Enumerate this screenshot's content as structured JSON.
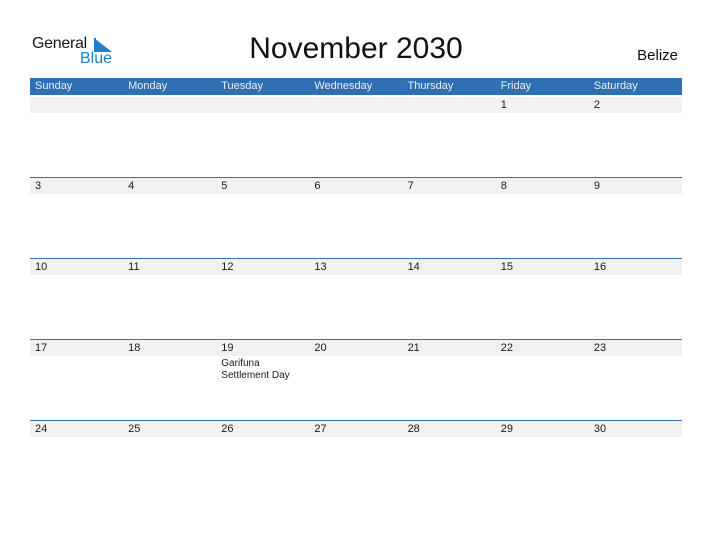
{
  "logo": {
    "line1": "General",
    "line2": "Blue"
  },
  "title": "November 2030",
  "country": "Belize",
  "colors": {
    "accent": "#2e70b2",
    "strip": "#f1f1f1",
    "logo_blue": "#1f7fc9"
  },
  "weekdays": [
    "Sunday",
    "Monday",
    "Tuesday",
    "Wednesday",
    "Thursday",
    "Friday",
    "Saturday"
  ],
  "weeks": [
    {
      "days": [
        "",
        "",
        "",
        "",
        "",
        "1",
        "2"
      ],
      "events": [
        "",
        "",
        "",
        "",
        "",
        "",
        ""
      ]
    },
    {
      "days": [
        "3",
        "4",
        "5",
        "6",
        "7",
        "8",
        "9"
      ],
      "events": [
        "",
        "",
        "",
        "",
        "",
        "",
        ""
      ]
    },
    {
      "days": [
        "10",
        "11",
        "12",
        "13",
        "14",
        "15",
        "16"
      ],
      "events": [
        "",
        "",
        "",
        "",
        "",
        "",
        ""
      ]
    },
    {
      "days": [
        "17",
        "18",
        "19",
        "20",
        "21",
        "22",
        "23"
      ],
      "events": [
        "",
        "",
        "Garifuna Settlement Day",
        "",
        "",
        "",
        ""
      ]
    },
    {
      "days": [
        "24",
        "25",
        "26",
        "27",
        "28",
        "29",
        "30"
      ],
      "events": [
        "",
        "",
        "",
        "",
        "",
        "",
        ""
      ]
    }
  ]
}
